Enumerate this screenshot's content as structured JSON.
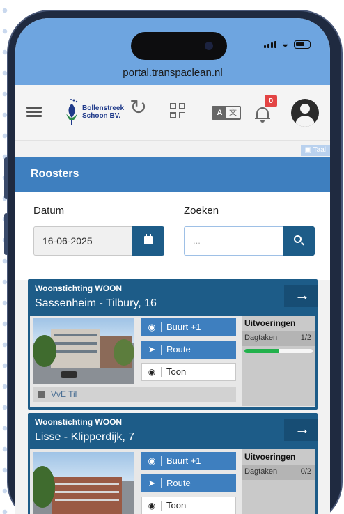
{
  "browser": {
    "url": "portal.transpaclean.nl"
  },
  "status": {
    "icons": [
      "signal-icon",
      "wifi-icon",
      "battery-icon"
    ]
  },
  "header": {
    "logo_line1": "Bollenstreek",
    "logo_line2": "Schoon BV.",
    "icons": [
      "hamburger-icon",
      "refresh-icon",
      "qr-icon",
      "translate-icon",
      "bell-icon",
      "avatar"
    ],
    "notification_count": "0",
    "taal_label": "Taal"
  },
  "section": {
    "title": "Roosters"
  },
  "filters": {
    "date_label": "Datum",
    "date_value": "16-06-2025",
    "search_label": "Zoeken",
    "search_placeholder": "..."
  },
  "colors": {
    "primary": "#1d5c88",
    "accent": "#3e7fbf",
    "status_bar": "#6ea5e0",
    "badge": "#e34444",
    "progress": "#22b14c"
  },
  "cards": [
    {
      "organization": "Woonstichting WOON",
      "location": "Sassenheim - Tilbury, 16",
      "arrow": "→",
      "actions": [
        {
          "icon": "map-pin-icon",
          "label": "Buurt +1"
        },
        {
          "icon": "navigation-icon",
          "label": "Route"
        },
        {
          "icon": "eye-icon",
          "label": "Toon"
        }
      ],
      "executions": {
        "title": "Uitvoeringen",
        "task": "Dagtaken",
        "count": "1/2",
        "progress": 0.5
      },
      "footer_tag": "VvE Til"
    },
    {
      "organization": "Woonstichting WOON",
      "location": "Lisse - Klipperdijk, 7",
      "arrow": "→",
      "actions": [
        {
          "icon": "map-pin-icon",
          "label": "Buurt +1"
        },
        {
          "icon": "navigation-icon",
          "label": "Route"
        },
        {
          "icon": "eye-icon",
          "label": "Toon"
        }
      ],
      "executions": {
        "title": "Uitvoeringen",
        "task": "Dagtaken",
        "count": "0/2",
        "progress": 0
      }
    }
  ]
}
